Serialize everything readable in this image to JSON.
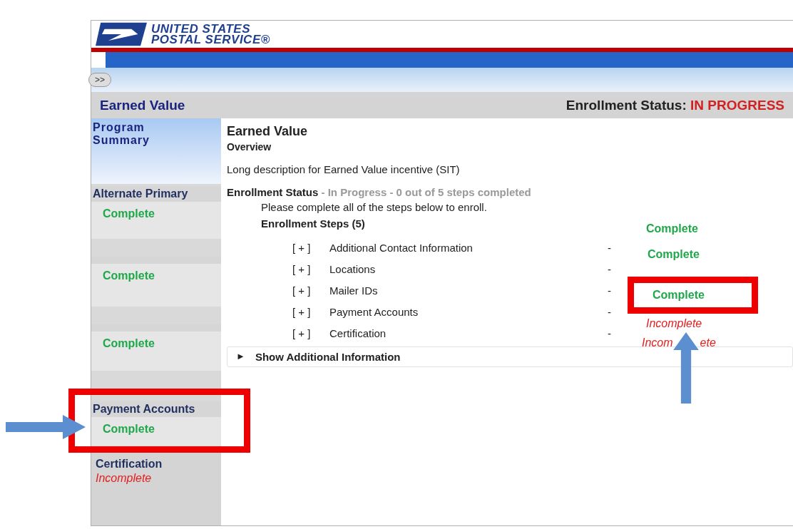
{
  "logo": {
    "line_1": "UNITED STATES",
    "line_2": "POSTAL SERVICE®"
  },
  "expand_button": ">>",
  "title_bar": {
    "title": "Earned Value",
    "status_label": "Enrollment Status:",
    "status_value": "IN PROGRESS"
  },
  "sidebar": {
    "heading": "Program Summary",
    "sections": [
      {
        "title": "Alternate Primary",
        "status": "Complete",
        "complete": true
      },
      {
        "status": "Complete",
        "complete": true
      },
      {
        "status": "Complete",
        "complete": true
      },
      {
        "title": "Payment Accounts",
        "status": "Complete",
        "complete": true
      },
      {
        "title": "Certification",
        "status": "Incomplete",
        "complete": false
      }
    ]
  },
  "content": {
    "title": "Earned Value",
    "subtitle": "Overview",
    "description": "Long description for Earned Value incentive (SIT)",
    "enrollment_status": {
      "label": "Enrollment Status",
      "detail": "- In Progress - 0 out of 5 steps completed"
    },
    "instruction": "Please complete all of the steps below to enroll.",
    "steps_heading": "Enrollment Steps (5)",
    "steps": [
      {
        "expander": "[ + ]",
        "name": "Additional Contact Information",
        "separator": "-"
      },
      {
        "expander": "[ + ]",
        "name": "Locations",
        "separator": "-"
      },
      {
        "expander": "[ + ]",
        "name": "Mailer IDs",
        "separator": "-"
      },
      {
        "expander": "[ + ]",
        "name": "Payment Accounts",
        "separator": "-"
      },
      {
        "expander": "[ + ]",
        "name": "Certification",
        "separator": "-"
      }
    ],
    "toggle": {
      "icon": "►",
      "label": "Show Additional Information"
    }
  },
  "pasted_statuses": [
    {
      "parts": [
        "Complete"
      ],
      "complete": true
    },
    {
      "parts": [
        "Complete"
      ],
      "complete": true
    },
    {
      "parts": [
        "Complete"
      ],
      "complete": true
    },
    {
      "parts": [
        "Incomplete"
      ],
      "complete": false
    },
    {
      "parts": [
        "Incom",
        "ete"
      ],
      "complete": false
    }
  ]
}
